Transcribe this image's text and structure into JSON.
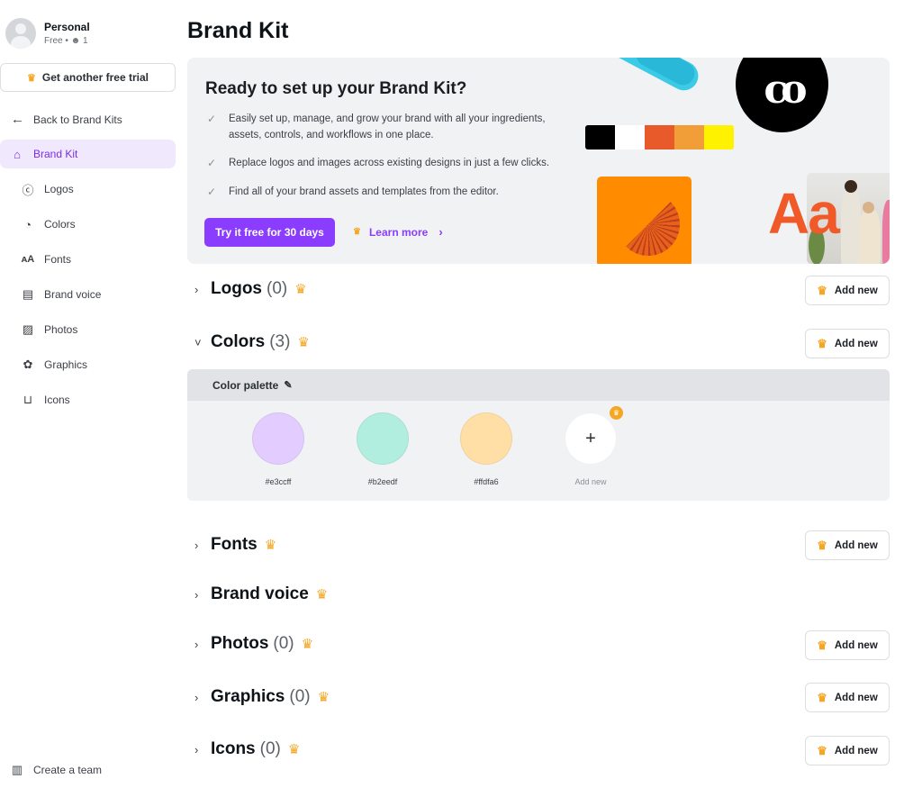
{
  "sidebar": {
    "profile": {
      "name": "Personal",
      "plan": "Free • ",
      "members": "1"
    },
    "trial_button": "Get another free trial",
    "back_link": "Back to Brand Kits",
    "items": [
      {
        "label": "Brand Kit",
        "icon": "brand-kit-icon",
        "active": true
      },
      {
        "label": "Logos",
        "icon": "logo-icon"
      },
      {
        "label": "Colors",
        "icon": "palette-icon"
      },
      {
        "label": "Fonts",
        "icon": "font-icon"
      },
      {
        "label": "Brand voice",
        "icon": "chat-icon"
      },
      {
        "label": "Photos",
        "icon": "image-icon"
      },
      {
        "label": "Graphics",
        "icon": "flower-icon"
      },
      {
        "label": "Icons",
        "icon": "shapes-icon"
      }
    ],
    "create_team": "Create a team"
  },
  "page": {
    "title": "Brand Kit"
  },
  "banner": {
    "title": "Ready to set up your Brand Kit?",
    "bullets": [
      "Easily set up, manage, and grow your brand with all your ingredients,",
      "assets, controls, and workflows in one place.",
      "Replace logos and images across existing designs in just a few clicks.",
      "Find all of your brand assets and templates from the editor."
    ],
    "try_button": "Try it free for 30 days",
    "learn_more": "Learn more",
    "logo_text": "co",
    "type_sample": "Aa",
    "swatches": [
      "#000000",
      "#ffffff",
      "#e85a2a",
      "#f19e38",
      "#fff200"
    ]
  },
  "sections": [
    {
      "title": "Logos",
      "count": "(0)",
      "expanded": false,
      "add_label": "Add new"
    },
    {
      "title": "Colors",
      "count": "(3)",
      "expanded": true,
      "add_label": "Add new"
    },
    {
      "title": "Fonts",
      "count": "",
      "expanded": false,
      "add_label": "Add new"
    },
    {
      "title": "Brand voice",
      "count": "",
      "expanded": false
    },
    {
      "title": "Photos",
      "count": "(0)",
      "expanded": false,
      "add_label": "Add new"
    },
    {
      "title": "Graphics",
      "count": "(0)",
      "expanded": false,
      "add_label": "Add new"
    },
    {
      "title": "Icons",
      "count": "(0)",
      "expanded": false,
      "add_label": "Add new"
    }
  ],
  "palette": {
    "title": "Color palette",
    "colors": [
      {
        "hex": "#e3ccff",
        "label": "#e3ccff"
      },
      {
        "hex": "#b2eedf",
        "label": "#b2eedf"
      },
      {
        "hex": "#ffdfa6",
        "label": "#ffdfa6"
      }
    ],
    "add_label": "Add new"
  },
  "icons": {
    "crown": "♛",
    "chevron_right": "›",
    "chevron_down": "˅",
    "check": "✓",
    "plus": "+",
    "pencil": "✎",
    "arrow_left": "←"
  }
}
